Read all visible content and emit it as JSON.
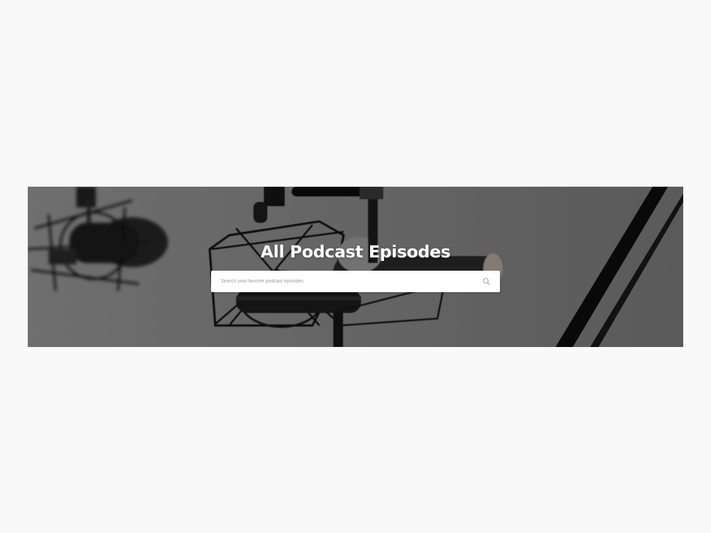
{
  "hero": {
    "title": "All Podcast Episodes",
    "background_image": "microphones-studio-photo"
  },
  "search": {
    "placeholder": "Search your favorite podcast episodes",
    "value": "",
    "icon": "search-icon"
  },
  "colors": {
    "page_background": "#f9f9f9",
    "title_text": "#ffffff",
    "search_background": "#ffffff",
    "placeholder_text": "#9a9a9a"
  }
}
